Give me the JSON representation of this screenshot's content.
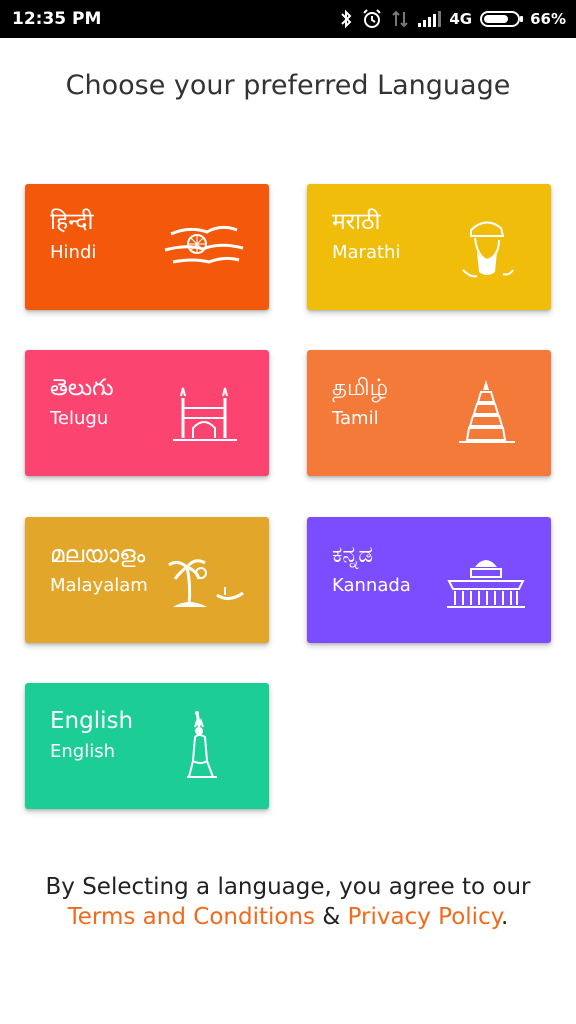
{
  "status_bar": {
    "time": "12:35 PM",
    "network": "4G",
    "battery": "66%"
  },
  "title": "Choose your preferred Language",
  "languages": [
    {
      "native": "हिन्दी",
      "english": "Hindi",
      "color": "#f4590b",
      "art": "chakra-clouds-icon"
    },
    {
      "native": "मराठी",
      "english": "Marathi",
      "color": "#f1bd0b",
      "art": "shivaji-portrait-icon"
    },
    {
      "native": "తెలుగు",
      "english": "Telugu",
      "color": "#fc4470",
      "art": "charminar-icon"
    },
    {
      "native": "தமிழ்",
      "english": "Tamil",
      "color": "#f47a3a",
      "art": "temple-gopuram-icon"
    },
    {
      "native": "മലയാളം",
      "english": "Malayalam",
      "color": "#e2a72a",
      "art": "palm-boat-icon"
    },
    {
      "native": "ಕನ್ನಡ",
      "english": "Kannada",
      "color": "#7c4dff",
      "art": "vidhana-soudha-icon"
    },
    {
      "native": "English",
      "english": "English",
      "color": "#1ccd96",
      "art": "statue-of-liberty-icon"
    }
  ],
  "footer": {
    "text_before": "By Selecting a language, you agree to our ",
    "terms_link": "Terms and Conditions",
    "separator": " & ",
    "privacy_link": "Privacy Policy",
    "text_after": "."
  }
}
